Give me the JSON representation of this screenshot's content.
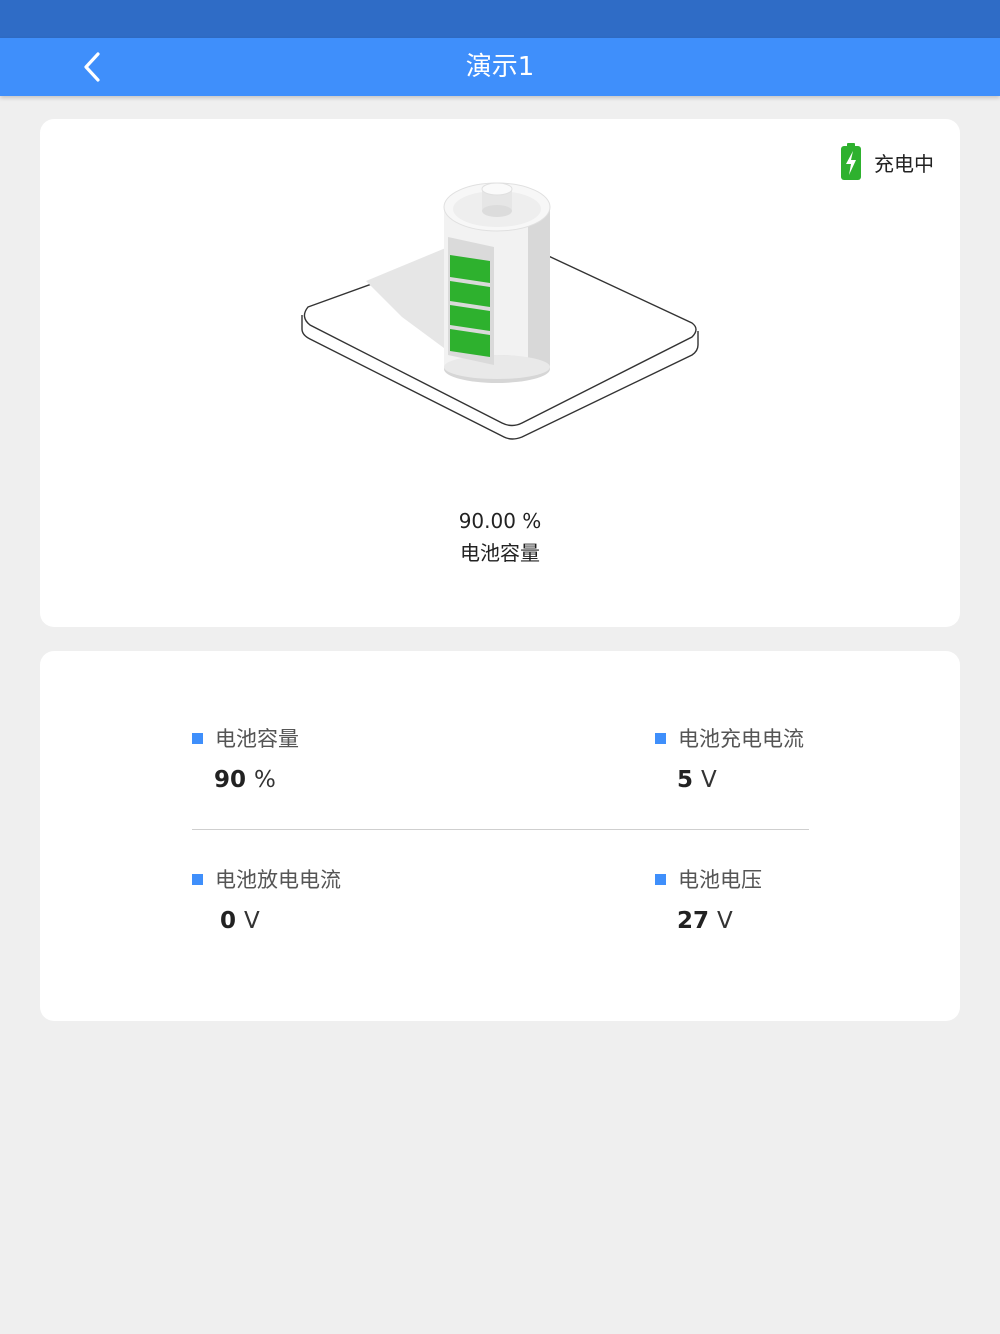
{
  "nav": {
    "title": "演示1",
    "back_icon": "chevron-left-icon"
  },
  "colors": {
    "status_bar": "#2f6cc6",
    "nav_bar": "#3f8ffb",
    "accent": "#3f8ffb",
    "charge_green": "#2eb12e",
    "background": "#efefef"
  },
  "status": {
    "charging_text": "充电中",
    "charging_icon": "battery-charging-icon"
  },
  "capacity": {
    "value": "90.00 %",
    "label": "电池容量",
    "level_fraction": 0.9
  },
  "stats": [
    {
      "label": "电池容量",
      "value": "90",
      "unit": "%"
    },
    {
      "label": "电池充电电流",
      "value": "5",
      "unit": "V"
    },
    {
      "label": "电池放电电流",
      "value": "0",
      "unit": "V"
    },
    {
      "label": "电池电压",
      "value": "27",
      "unit": "V"
    }
  ]
}
